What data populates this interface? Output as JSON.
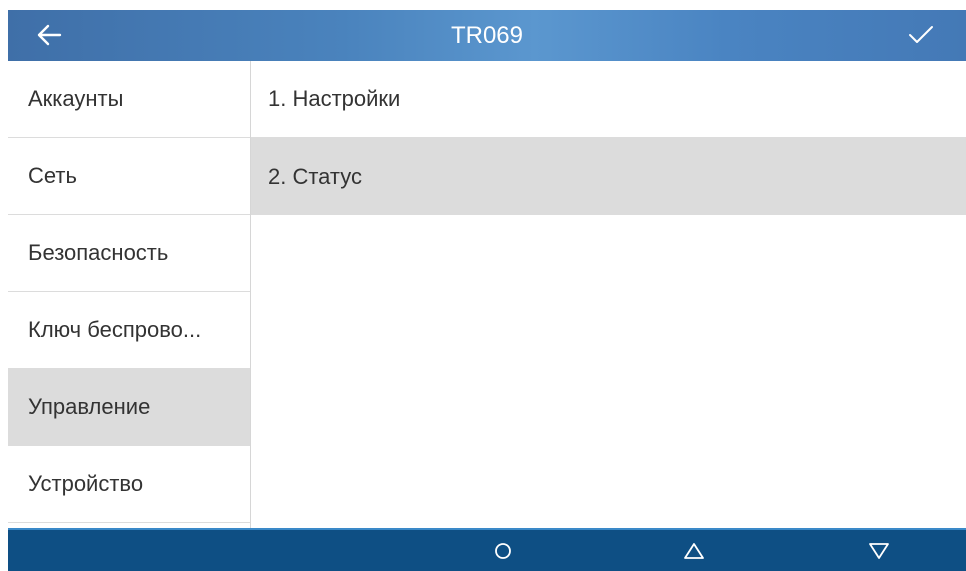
{
  "header": {
    "title": "TR069",
    "back_icon": "arrow-left-icon",
    "confirm_icon": "checkmark-icon"
  },
  "sidebar": {
    "items": [
      {
        "label": "Аккаунты",
        "selected": false
      },
      {
        "label": "Сеть",
        "selected": false
      },
      {
        "label": "Безопасность",
        "selected": false
      },
      {
        "label": "Ключ беспрово...",
        "selected": false
      },
      {
        "label": "Управление",
        "selected": true
      },
      {
        "label": "Устройство",
        "selected": false
      }
    ]
  },
  "main": {
    "items": [
      {
        "label": "1.  Настройки",
        "selected": false
      },
      {
        "label": "2.  Статус",
        "selected": true
      }
    ]
  },
  "softkeys": {
    "icons": [
      "circle-icon",
      "triangle-up-icon",
      "triangle-down-icon"
    ]
  },
  "colors": {
    "header": "#4a83bd",
    "bottom_bar": "#0e4f84",
    "selection": "#dcdcdc"
  }
}
